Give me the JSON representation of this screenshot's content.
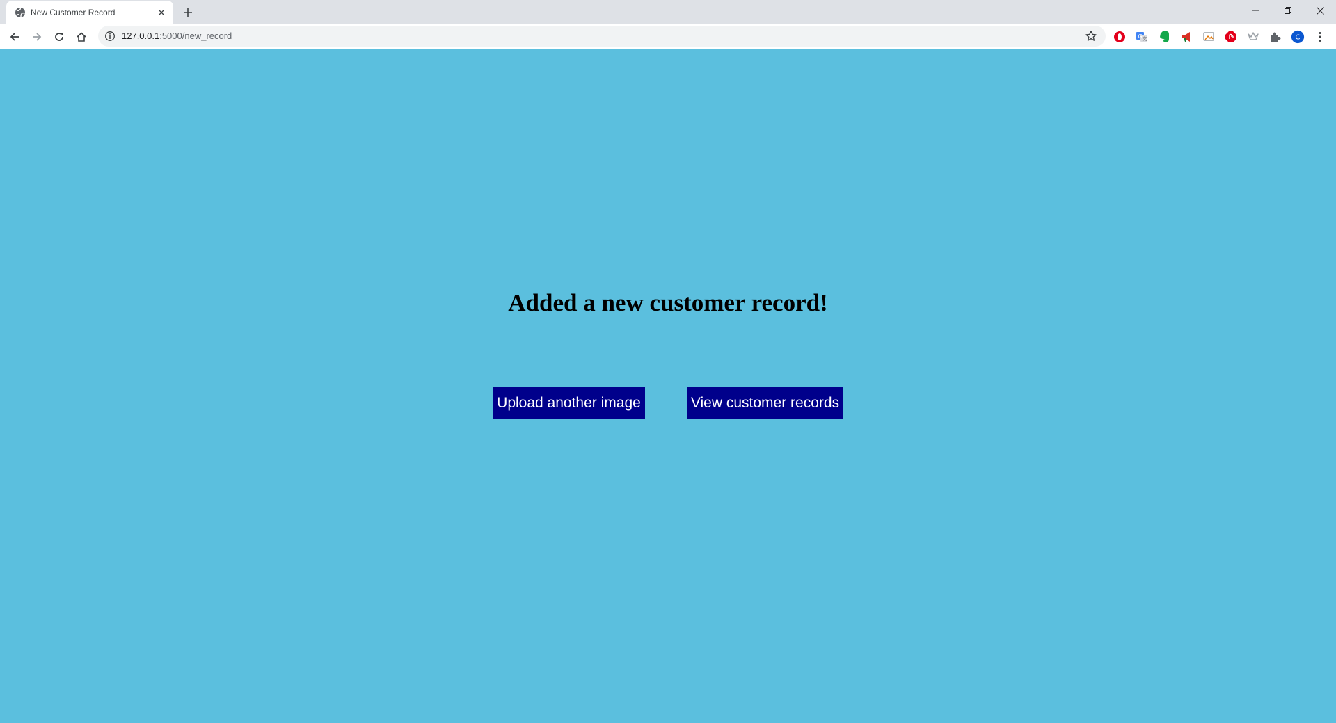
{
  "browser": {
    "tab": {
      "title": "New Customer Record",
      "favicon_icon": "globe-icon",
      "close_icon": "close-icon"
    },
    "new_tab_icon": "plus-icon",
    "window_controls": [
      "minimize-icon",
      "restore-icon",
      "close-icon"
    ],
    "toolbar": {
      "back_icon": "back-arrow-icon",
      "forward_icon": "forward-arrow-icon",
      "reload_icon": "reload-icon",
      "home_icon": "home-icon",
      "address": {
        "host": "127.0.0.1",
        "path": ":5000/new_record",
        "info_icon": "info-icon",
        "bookmark_icon": "star-icon"
      },
      "extensions": [
        {
          "icon": "opera-icon",
          "color": "#e3001b"
        },
        {
          "icon": "translate-icon",
          "color": "#4285f4"
        },
        {
          "icon": "evernote-icon",
          "color": "#14a84b"
        },
        {
          "icon": "megaphone-icon",
          "color": "#d93025"
        },
        {
          "icon": "cast-icon",
          "color": "#9aa0a6"
        },
        {
          "icon": "adblock-icon",
          "color": "#e3001b"
        },
        {
          "icon": "crown-icon",
          "color": "#9aa0a6"
        },
        {
          "icon": "puzzle-icon",
          "color": "#5f6368"
        }
      ],
      "profile": {
        "initial": "C",
        "color": "#0b57d0"
      },
      "menu_icon": "kebab-menu-icon"
    }
  },
  "page": {
    "background": "#5bbfde",
    "heading": "Added a new customer record!",
    "buttons": {
      "upload": "Upload another image",
      "view": "View customer records"
    },
    "button_color": "#00008b"
  }
}
